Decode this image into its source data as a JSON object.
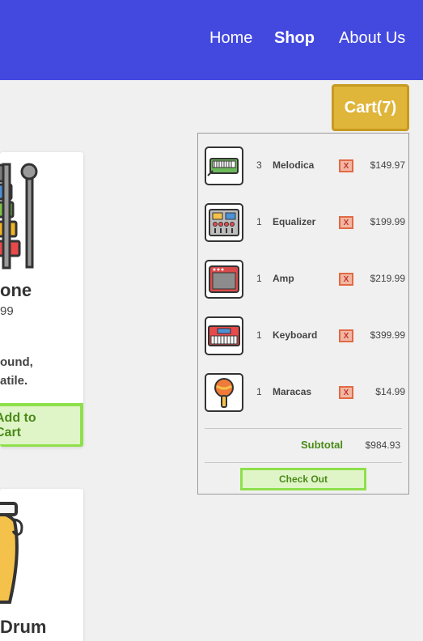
{
  "nav": {
    "home": "Home",
    "shop": "Shop",
    "about": "About Us"
  },
  "cart_button": {
    "label": "Cart(7)"
  },
  "products": [
    {
      "name": "one",
      "price": "99",
      "desc_line1": "ound,",
      "desc_line2": "atile.",
      "add_label": "Add to Cart"
    },
    {
      "name": "Drum"
    }
  ],
  "cart": {
    "items": [
      {
        "qty": "3",
        "name": "Melodica",
        "remove": "X",
        "price": "$149.97",
        "icon": "melodica-icon"
      },
      {
        "qty": "1",
        "name": "Equalizer",
        "remove": "X",
        "price": "$199.99",
        "icon": "equalizer-icon"
      },
      {
        "qty": "1",
        "name": "Amp",
        "remove": "X",
        "price": "$219.99",
        "icon": "amp-icon"
      },
      {
        "qty": "1",
        "name": "Keyboard",
        "remove": "X",
        "price": "$399.99",
        "icon": "keyboard-icon"
      },
      {
        "qty": "1",
        "name": "Maracas",
        "remove": "X",
        "price": "$14.99",
        "icon": "maracas-icon"
      }
    ],
    "subtotal_label": "Subtotal",
    "subtotal_value": "$984.93",
    "checkout_label": "Check Out"
  },
  "colors": {
    "header": "#4349df",
    "cart_button": "#dfb53a",
    "accent_green": "#8ee04a",
    "remove_red": "#e06a44"
  }
}
